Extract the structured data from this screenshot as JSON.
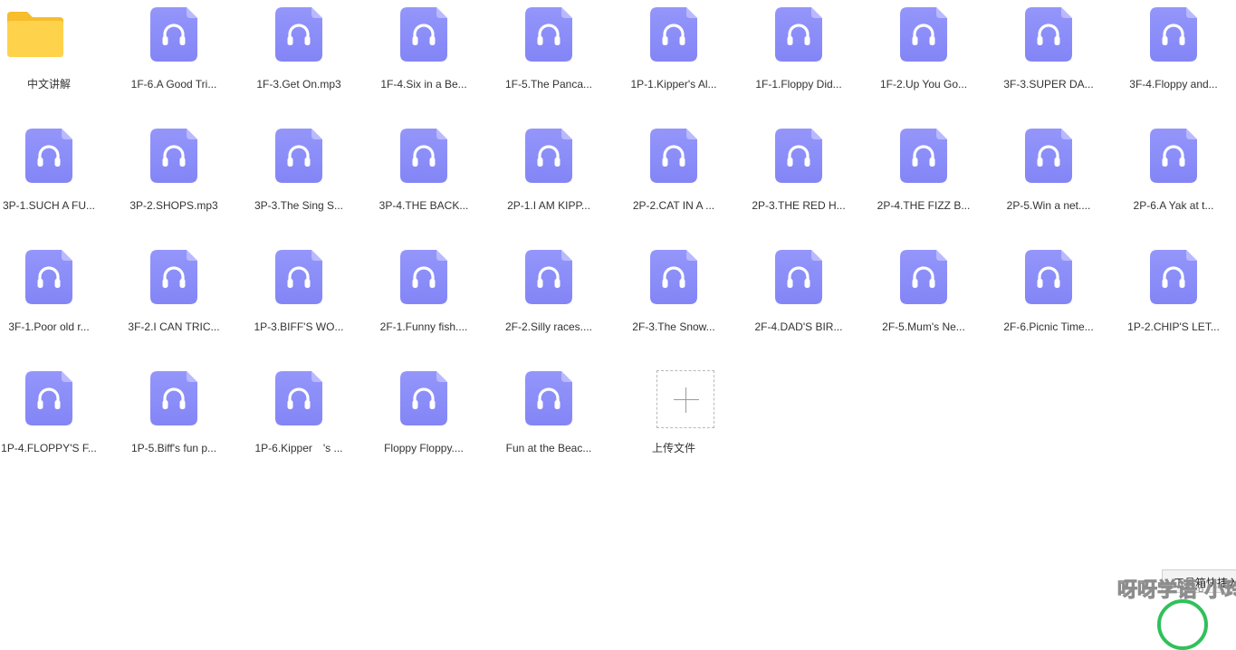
{
  "folder": {
    "label": "中文讲解",
    "icon": "folder-icon"
  },
  "files": [
    "1F-6.A Good Tri...",
    "1F-3.Get On.mp3",
    "1F-4.Six in a Be...",
    "1F-5.The Panca...",
    "1P-1.Kipper's Al...",
    "1F-1.Floppy Did...",
    "1F-2.Up You Go...",
    "3F-3.SUPER DA...",
    "3F-4.Floppy and...",
    "3P-1.SUCH A FU...",
    "3P-2.SHOPS.mp3",
    "3P-3.The Sing S...",
    "3P-4.THE BACK...",
    "2P-1.I AM KIPP...",
    "2P-2.CAT IN A ...",
    "2P-3.THE RED H...",
    "2P-4.THE FIZZ B...",
    "2P-5.Win a net....",
    "2P-6.A Yak at t...",
    "3F-1.Poor old r...",
    "3F-2.I CAN TRIC...",
    "1P-3.BIFF'S WO...",
    "2F-1.Funny fish....",
    "2F-2.Silly races....",
    "2F-3.The Snow...",
    "2F-4.DAD'S BIR...",
    "2F-5.Mum's Ne...",
    "2F-6.Picnic Time...",
    "1P-2.CHIP'S LET...",
    "1P-4.FLOPPY'S F...",
    "1P-5.Biff's fun p...",
    "1P-6.Kipper　's ...",
    "Floppy Floppy....",
    "Fun at the Beac..."
  ],
  "file_icon": "audio-file-icon",
  "upload": {
    "label": "上传文件",
    "icon": "plus-icon"
  },
  "tool_popup": {
    "text": "工具箱快捷入"
  },
  "watermark": {
    "text": "呀呀学语·小玲团"
  },
  "colors": {
    "file_icon": "#8a8cf8",
    "folder": "#ffd24c",
    "label_text": "#333333",
    "green_ring": "#2fc15a"
  }
}
